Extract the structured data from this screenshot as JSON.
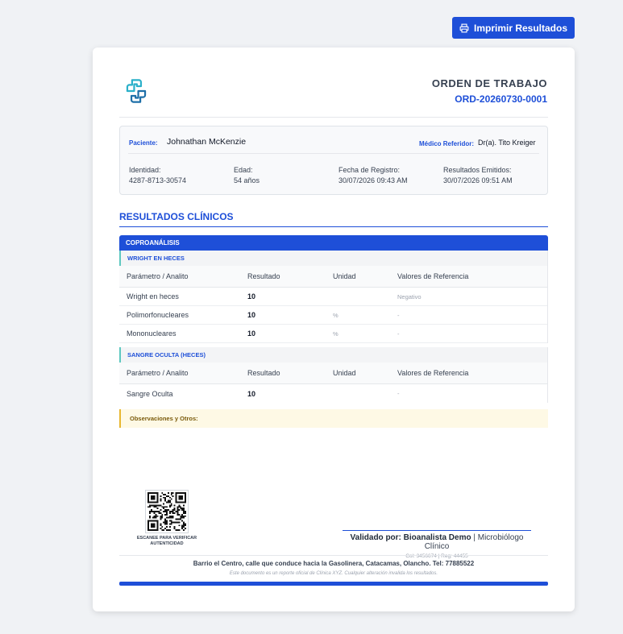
{
  "print_button": {
    "label": "Imprimir Resultados"
  },
  "header": {
    "title": "ORDEN DE TRABAJO",
    "order_code": "ORD-20260730-0001"
  },
  "patient": {
    "patient_label": "Paciente:",
    "patient_name": "Johnathan McKenzie",
    "doctor_label": "Médico Referidor:",
    "doctor_name": "Dr(a). Tito Kreiger",
    "fields": [
      {
        "label": "Identidad:",
        "value": "4287-8713-30574"
      },
      {
        "label": "Edad:",
        "value": "54 años"
      },
      {
        "label": "Fecha de Registro:",
        "value": "30/07/2026 09:43 AM"
      },
      {
        "label": "Resultados Emitidos:",
        "value": "30/07/2026 09:51 AM"
      }
    ]
  },
  "results": {
    "section_title": "RESULTADOS CLÍNICOS",
    "category": "COPROANÁLISIS",
    "columns": [
      "Parámetro / Analito",
      "Resultado",
      "Unidad",
      "Valores de Referencia"
    ],
    "groups": [
      {
        "name": "WRIGHT EN HECES",
        "rows": [
          {
            "param": "Wright en heces",
            "result": "10",
            "unit": "",
            "ref": "Negativo"
          },
          {
            "param": "Polimorfonucleares",
            "result": "10",
            "unit": "%",
            "ref": "-"
          },
          {
            "param": "Mononucleares",
            "result": "10",
            "unit": "%",
            "ref": "-"
          }
        ]
      },
      {
        "name": "SANGRE OCULTA (HECES)",
        "rows": [
          {
            "param": "Sangre Oculta",
            "result": "10",
            "unit": "",
            "ref": "-"
          }
        ]
      }
    ],
    "observations_label": "Observaciones y Otros:"
  },
  "qr": {
    "caption_line1": "ESCANEE PARA VERIFICAR",
    "caption_line2": "AUTENTICIDAD"
  },
  "validator": {
    "prefix": "Validado por:",
    "name": "Bioanalista Demo",
    "separator": " | ",
    "role": "Microbiólogo Clínico",
    "credentials": "Col: 3456674  |  Reg: 44455"
  },
  "footer": {
    "address": "Barrio el Centro, calle que conduce hacia la Gasolinera, Catacamas, Olancho. Tel: 77885522",
    "disclaimer": "Este documento es un reporte oficial de Clínica XYZ. Cualquier alteración invalida los resultados."
  },
  "colors": {
    "primary": "#1e4fd8",
    "accent_teal": "#5ec8c0",
    "observations_bg": "#fef9e5",
    "observations_border": "#e8b730"
  }
}
